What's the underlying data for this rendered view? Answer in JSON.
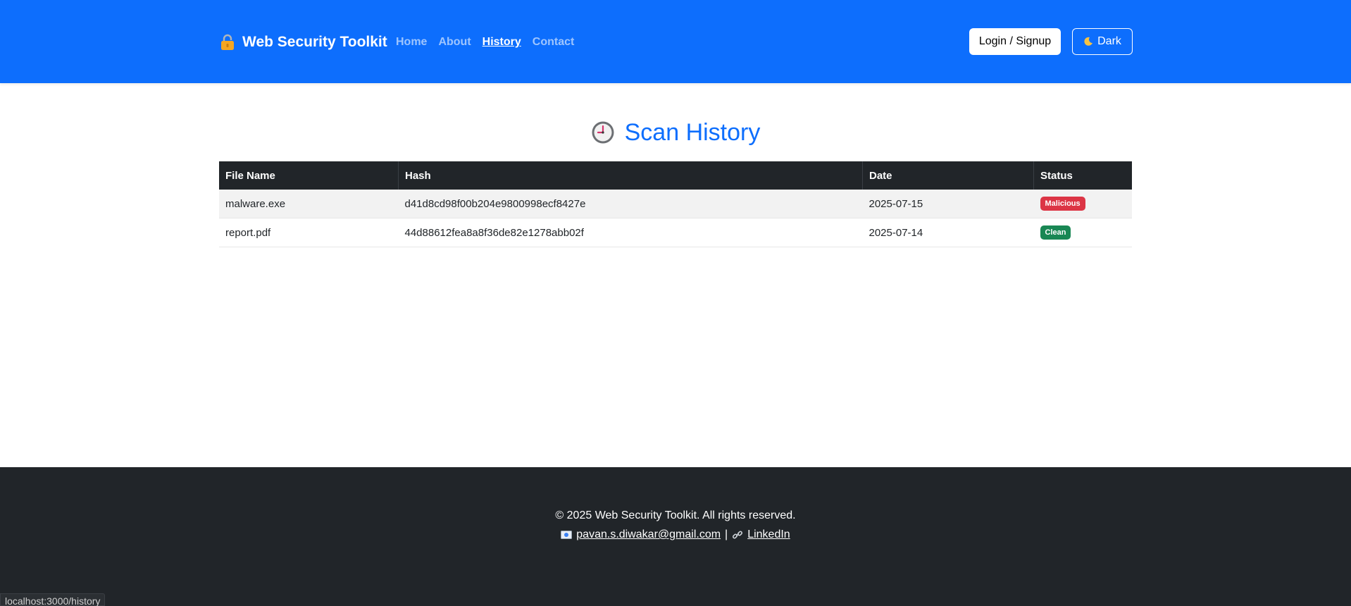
{
  "navbar": {
    "brand": "Web Security Toolkit",
    "links": [
      {
        "label": "Home"
      },
      {
        "label": "About"
      },
      {
        "label": "History"
      },
      {
        "label": "Contact"
      }
    ],
    "login_label": "Login / Signup",
    "theme_label": "Dark"
  },
  "main": {
    "title": "Scan History",
    "table": {
      "headers": [
        "File Name",
        "Hash",
        "Date",
        "Status"
      ],
      "rows": [
        {
          "file": "malware.exe",
          "hash": "d41d8cd98f00b204e9800998ecf8427e",
          "date": "2025-07-15",
          "status": "Malicious"
        },
        {
          "file": "report.pdf",
          "hash": "44d88612fea8a8f36de82e1278abb02f",
          "date": "2025-07-14",
          "status": "Clean"
        }
      ]
    }
  },
  "footer": {
    "copyright": "© 2025 Web Security Toolkit. All rights reserved.",
    "email": "pavan.s.diwakar@gmail.com",
    "separator": "|",
    "linkedin": "LinkedIn"
  },
  "status_bar": {
    "url": "localhost:3000/history"
  },
  "colors": {
    "primary": "#0d6efd",
    "dark": "#212529",
    "danger": "#dc3545",
    "success": "#198754"
  },
  "icons": {
    "brand": "lock-icon",
    "theme": "moon-icon",
    "title": "clock-icon",
    "email": "email-icon",
    "linkedin": "link-icon"
  }
}
